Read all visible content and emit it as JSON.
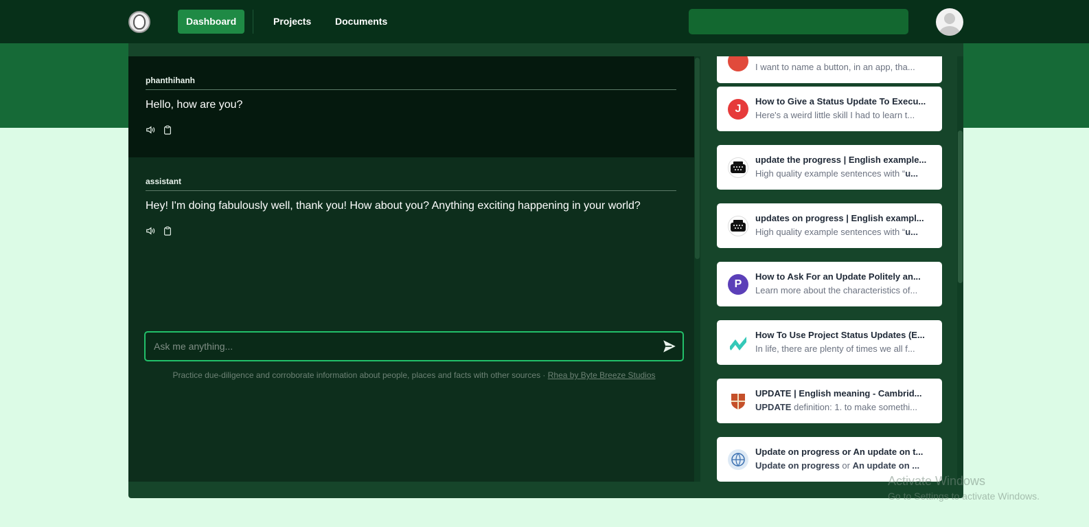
{
  "nav": {
    "dashboard": "Dashboard",
    "projects": "Projects",
    "documents": "Documents"
  },
  "messages": [
    {
      "author": "phanthihanh",
      "text": "Hello, how are you?"
    },
    {
      "author": "assistant",
      "text": "Hey! I'm doing fabulously well, thank you! How about you? Anything exciting happening in your world?"
    }
  ],
  "chat_input": {
    "placeholder": "Ask me anything..."
  },
  "disclaimer": {
    "text": "Practice due-diligence and corroborate information about people, places and facts with other sources · ",
    "link": "Rhea by Byte Breeze Studios"
  },
  "results": [
    {
      "title": "",
      "snippet": "I want to name a button, in an app, tha...",
      "icon": "red-dot",
      "color": "#e14a3b"
    },
    {
      "title": "How to Give a Status Update To Execu...",
      "snippet": "Here's a weird little skill I had to learn t...",
      "icon": "letter-j",
      "color": "#e63a3a",
      "icon_text": "J"
    },
    {
      "title": "update the progress | English example...",
      "snippet_plain": "High quality example sentences with “",
      "snippet_bold": "u...",
      "icon": "typewriter-icon",
      "color": "#111111"
    },
    {
      "title": "updates on progress | English exampl...",
      "snippet_plain": "High quality example sentences with “",
      "snippet_bold": "u...",
      "icon": "typewriter-icon",
      "color": "#111111"
    },
    {
      "title": "How to Ask For an Update Politely an...",
      "snippet": "Learn more about the characteristics of...",
      "icon": "letter-p",
      "color": "#5b3fb8",
      "icon_text": "P"
    },
    {
      "title": "How To Use Project Status Updates (E...",
      "snippet": "In life, there are plenty of times we all f...",
      "icon": "zigzag-logo",
      "color": "#34c8b8"
    },
    {
      "title": "UPDATE | English meaning - Cambrid...",
      "snippet_bold": "UPDATE",
      "snippet_plain": " definition: 1. to make somethi...",
      "icon": "cambridge-shield",
      "color": "#c5502a"
    },
    {
      "title": "Update on progress or An update on t...",
      "snippet_bold": "Update on progress",
      "snippet_mid": " or ",
      "snippet_bold2": "An update on ...",
      "icon": "globe-logo",
      "color": "#dde9f5"
    }
  ],
  "watermark": {
    "line1": "Activate Windows",
    "line2": "Go to Settings to activate Windows."
  }
}
